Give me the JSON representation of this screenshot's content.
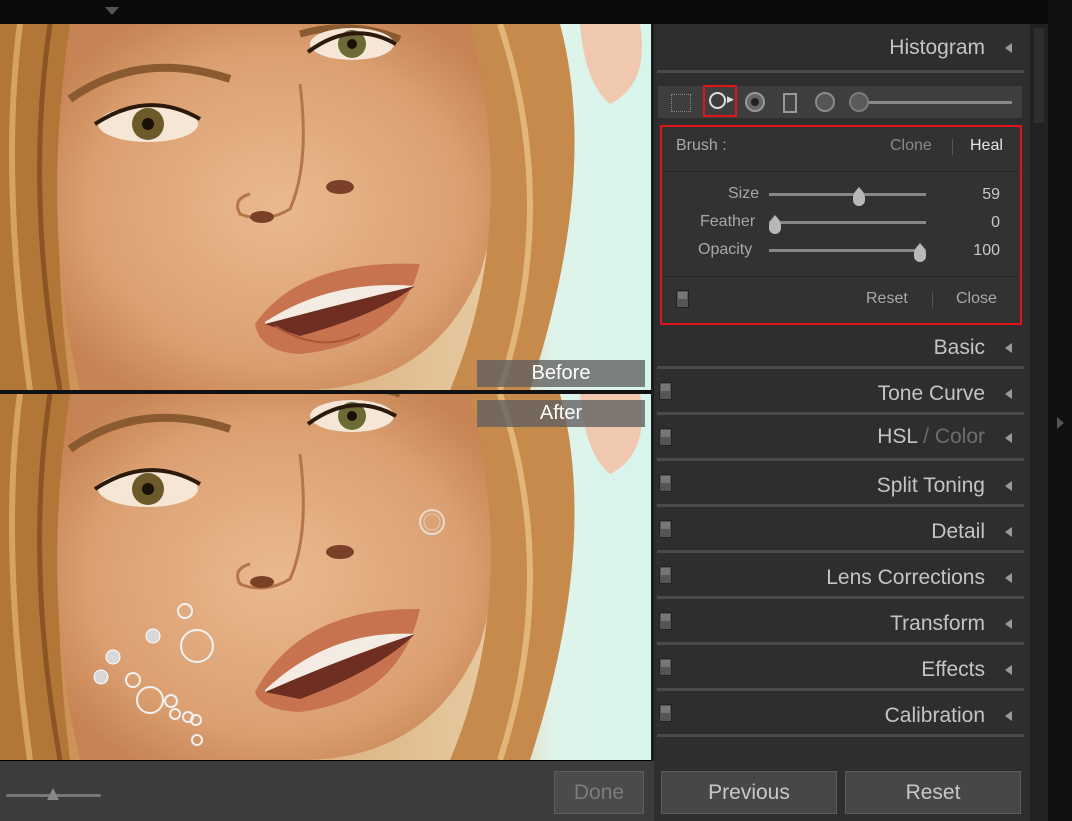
{
  "preview": {
    "before_label": "Before",
    "after_label": "After"
  },
  "bottom_toolbar": {
    "done_label": "Done"
  },
  "panel": {
    "histogram_title": "Histogram",
    "spot_removal": {
      "brush_label": "Brush :",
      "clone_label": "Clone",
      "heal_label": "Heal",
      "active_mode": "Heal",
      "size_label": "Size",
      "size_value": "59",
      "size_fraction": 0.58,
      "feather_label": "Feather",
      "feather_value": "0",
      "feather_fraction": 0.0,
      "opacity_label": "Opacity",
      "opacity_value": "100",
      "opacity_fraction": 1.0,
      "reset_label": "Reset",
      "close_label": "Close"
    },
    "sections": {
      "basic": "Basic",
      "tone_curve": "Tone Curve",
      "hsl": "HSL",
      "hsl_sep": "/",
      "color": "Color",
      "split_toning": "Split Toning",
      "detail": "Detail",
      "lens_corrections": "Lens Corrections",
      "transform": "Transform",
      "effects": "Effects",
      "calibration": "Calibration"
    },
    "previous_label": "Previous",
    "reset_label": "Reset"
  },
  "colors": {
    "highlight": "#e0141a",
    "panel_bg": "#2e2e2e"
  }
}
